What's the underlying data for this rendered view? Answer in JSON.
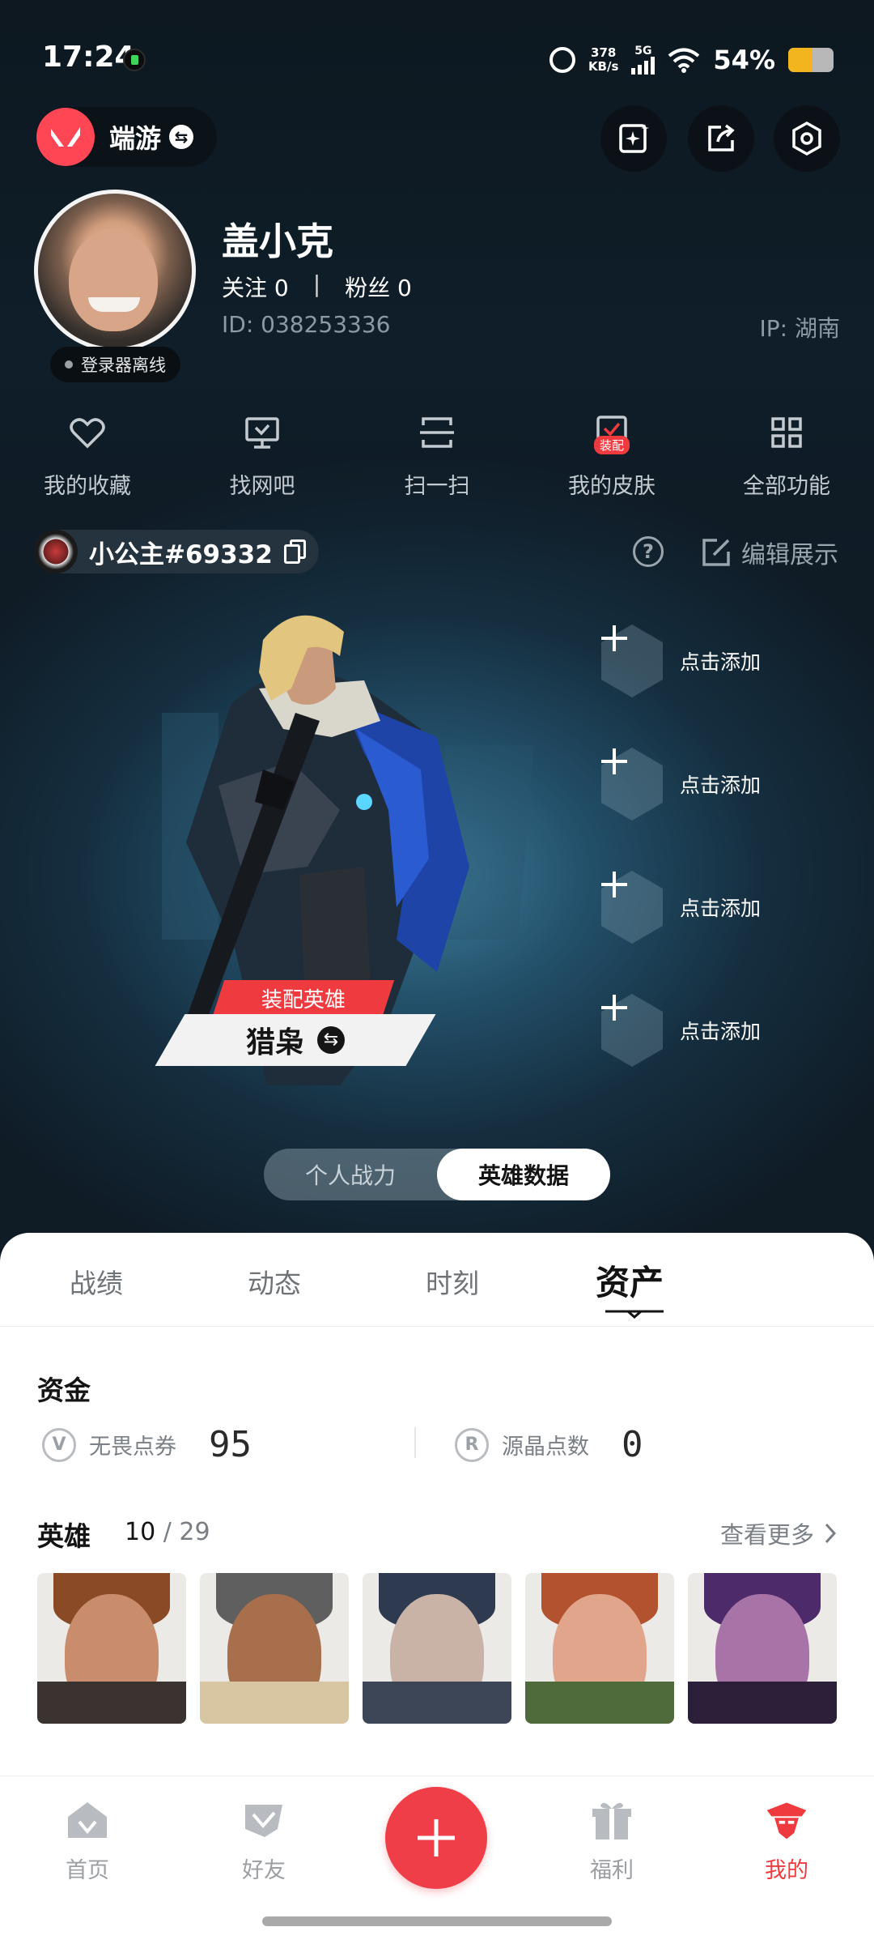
{
  "status_bar": {
    "time": "17:24",
    "net_speed_value": "378",
    "net_speed_unit": "KB/s",
    "signal_label": "5G",
    "battery_pct": "54%",
    "battery_level": 0.54
  },
  "header": {
    "app_label": "端游",
    "app_switch_icon": "swap-icon",
    "actions": [
      "sparkle-card-icon",
      "share-icon",
      "settings-hex-icon"
    ]
  },
  "profile": {
    "status": "登录器离线",
    "name": "盖小克",
    "following": "关注 0",
    "separator": "|",
    "followers": "粉丝 0",
    "id": "ID:  038253336",
    "ip": "IP:  湖南"
  },
  "shortcuts": [
    {
      "label": "我的收藏",
      "icon": "heart-icon"
    },
    {
      "label": "找网吧",
      "icon": "monitor-icon"
    },
    {
      "label": "扫一扫",
      "icon": "scan-icon"
    },
    {
      "label": "我的皮肤",
      "icon": "skin-icon",
      "tag": "装配"
    },
    {
      "label": "全部功能",
      "icon": "grid-icon"
    }
  ],
  "player": {
    "name": "小公主#69332",
    "edit_label": "编辑展示"
  },
  "showcase": {
    "equip_badge": "装配英雄",
    "hero_name": "猎枭",
    "slots": [
      "点击添加",
      "点击添加",
      "点击添加",
      "点击添加"
    ]
  },
  "toggle": {
    "options": [
      "个人战力",
      "英雄数据"
    ],
    "active": 1
  },
  "tabs": {
    "items": [
      "战绩",
      "动态",
      "时刻",
      "资产"
    ],
    "active": 3
  },
  "funds": {
    "title": "资金",
    "items": [
      {
        "label": "无畏点券",
        "value": "95",
        "icon": "valorant-points-icon"
      },
      {
        "label": "源晶点数",
        "value": "0",
        "icon": "radianite-icon"
      }
    ]
  },
  "heroes": {
    "title": "英雄",
    "owned": "10",
    "sep": "/",
    "total": "29",
    "more_label": "查看更多"
  },
  "nav": {
    "items": [
      {
        "label": "首页",
        "icon": "home-icon"
      },
      {
        "label": "好友",
        "icon": "friends-icon"
      },
      {
        "label": "福利",
        "icon": "gift-icon"
      },
      {
        "label": "我的",
        "icon": "profile-agent-icon"
      }
    ],
    "active": 3,
    "fab_icon": "plus-icon"
  },
  "colors": {
    "accent": "#ef3b3f",
    "hero_bg": "#1b3a4e",
    "sheet_bg": "#ffffff"
  }
}
